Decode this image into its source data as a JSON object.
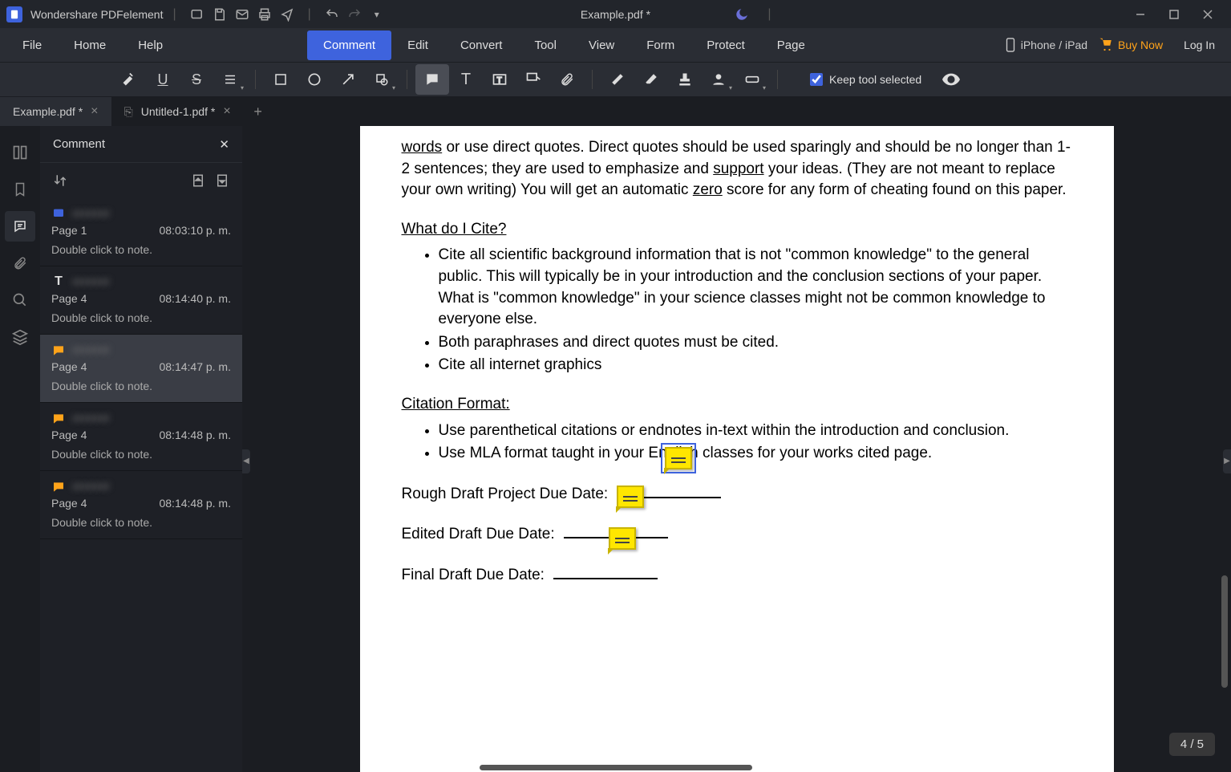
{
  "app": {
    "name": "Wondershare PDFelement",
    "document_title": "Example.pdf *"
  },
  "menus": {
    "file": "File",
    "home": "Home",
    "help": "Help",
    "ribbon": [
      "Comment",
      "Edit",
      "Convert",
      "Tool",
      "View",
      "Form",
      "Protect",
      "Page"
    ],
    "active_ribbon": "Comment",
    "iphone": "iPhone / iPad",
    "buy": "Buy Now",
    "login": "Log In",
    "keep_tool": "Keep tool selected"
  },
  "tabs": [
    {
      "label": "Example.pdf *",
      "active": true
    },
    {
      "label": "Untitled-1.pdf *",
      "active": false
    }
  ],
  "panel": {
    "title": "Comment"
  },
  "comments": [
    {
      "icon": "highlight",
      "author": "######",
      "page": "Page 1",
      "time": "08:03:10 p. m.",
      "note": "Double click to note."
    },
    {
      "icon": "text",
      "author": "######",
      "page": "Page 4",
      "time": "08:14:40 p. m.",
      "note": "Double click to note."
    },
    {
      "icon": "sticky",
      "author": "######",
      "page": "Page 4",
      "time": "08:14:47 p. m.",
      "note": "Double click to note.",
      "selected": true
    },
    {
      "icon": "sticky",
      "author": "######",
      "page": "Page 4",
      "time": "08:14:48 p. m.",
      "note": "Double click to note."
    },
    {
      "icon": "sticky",
      "author": "######",
      "page": "Page 4",
      "time": "08:14:48 p. m.",
      "note": "Double click to note."
    }
  ],
  "doc": {
    "top_fragment_a": "words",
    "top_text_a": " or use direct quotes.   Direct quotes should be used sparingly and should be no longer than 1-2 sentences; they are used to emphasize and ",
    "support": "support",
    "top_text_b": " your ideas.  (They are not meant to replace your own writing) You will get an automatic ",
    "zero": "zero",
    "top_text_c": " score for any form of cheating found on this paper.",
    "h1": "What do I Cite?",
    "b1": "Cite all scientific background information that is not \"common knowledge\" to the general public.  This will typically be in your introduction and the conclusion sections of your paper. What is \"common knowledge\" in your science classes might not be common knowledge to everyone else.",
    "b2": "Both paraphrases and direct quotes must be cited.",
    "b3": "Cite all internet graphics",
    "h2": "Citation Format:",
    "c1": "Use parenthetical citations or endnotes in-text within the introduction and conclusion.",
    "c2": "Use MLA format taught in your English classes for your works cited page.",
    "rough": "Rough Draft Project Due Date:",
    "edited": "Edited Draft Due Date:",
    "final": "Final Draft Due Date:"
  },
  "page_indicator": "4 / 5"
}
